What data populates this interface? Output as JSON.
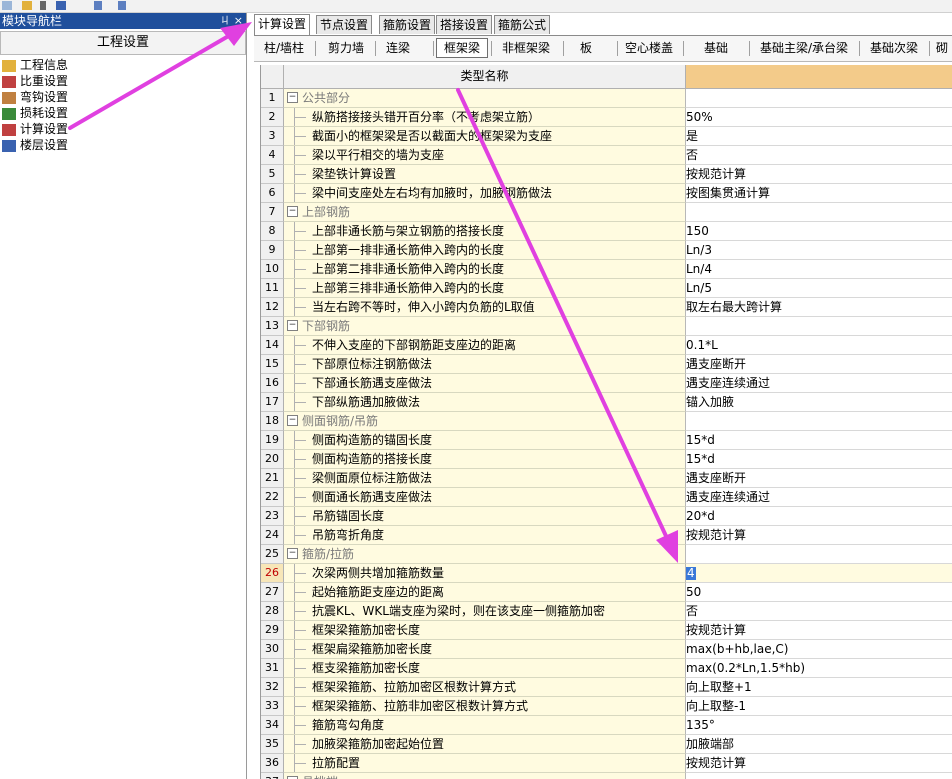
{
  "nav": {
    "title": "模块导航栏",
    "pin": "ㄐ",
    "close": "×",
    "header": "工程设置",
    "items": [
      {
        "label": "工程信息",
        "icon": "info-icon"
      },
      {
        "label": "比重设置",
        "icon": "scale-icon"
      },
      {
        "label": "弯钩设置",
        "icon": "hook-icon"
      },
      {
        "label": "损耗设置",
        "icon": "loss-icon"
      },
      {
        "label": "计算设置",
        "icon": "calc-icon"
      },
      {
        "label": "楼层设置",
        "icon": "floor-icon"
      }
    ]
  },
  "tabs": [
    "计算设置",
    "节点设置",
    "箍筋设置",
    "搭接设置",
    "箍筋公式"
  ],
  "categories": [
    "柱/墙柱",
    "剪力墙",
    "连梁",
    "框架梁",
    "非框架梁",
    "板",
    "空心楼盖",
    "基础",
    "基础主梁/承台梁",
    "基础次梁",
    "砌"
  ],
  "grid": {
    "header": "类型名称",
    "rows": [
      {
        "n": "1",
        "name": "公共部分",
        "value": "",
        "group": true
      },
      {
        "n": "2",
        "name": "纵筋搭接接头错开百分率（不考虑架立筋）",
        "value": "50%"
      },
      {
        "n": "3",
        "name": "截面小的框架梁是否以截面大的框架梁为支座",
        "value": "是"
      },
      {
        "n": "4",
        "name": "梁以平行相交的墙为支座",
        "value": "否"
      },
      {
        "n": "5",
        "name": "梁垫铁计算设置",
        "value": "按规范计算"
      },
      {
        "n": "6",
        "name": "梁中间支座处左右均有加腋时，加腋钢筋做法",
        "value": "按图集贯通计算"
      },
      {
        "n": "7",
        "name": "上部钢筋",
        "value": "",
        "group": true
      },
      {
        "n": "8",
        "name": "上部非通长筋与架立钢筋的搭接长度",
        "value": "150"
      },
      {
        "n": "9",
        "name": "上部第一排非通长筋伸入跨内的长度",
        "value": "Ln/3"
      },
      {
        "n": "10",
        "name": "上部第二排非通长筋伸入跨内的长度",
        "value": "Ln/4"
      },
      {
        "n": "11",
        "name": "上部第三排非通长筋伸入跨内的长度",
        "value": "Ln/5"
      },
      {
        "n": "12",
        "name": "当左右跨不等时，伸入小跨内负筋的L取值",
        "value": "取左右最大跨计算"
      },
      {
        "n": "13",
        "name": "下部钢筋",
        "value": "",
        "group": true
      },
      {
        "n": "14",
        "name": "不伸入支座的下部钢筋距支座边的距离",
        "value": "0.1*L"
      },
      {
        "n": "15",
        "name": "下部原位标注钢筋做法",
        "value": "遇支座断开"
      },
      {
        "n": "16",
        "name": "下部通长筋遇支座做法",
        "value": "遇支座连续通过"
      },
      {
        "n": "17",
        "name": "下部纵筋遇加腋做法",
        "value": "锚入加腋"
      },
      {
        "n": "18",
        "name": "侧面钢筋/吊筋",
        "value": "",
        "group": true
      },
      {
        "n": "19",
        "name": "侧面构造筋的锚固长度",
        "value": "15*d"
      },
      {
        "n": "20",
        "name": "侧面构造筋的搭接长度",
        "value": "15*d"
      },
      {
        "n": "21",
        "name": "梁侧面原位标注筋做法",
        "value": "遇支座断开"
      },
      {
        "n": "22",
        "name": "侧面通长筋遇支座做法",
        "value": "遇支座连续通过"
      },
      {
        "n": "23",
        "name": "吊筋锚固长度",
        "value": "20*d"
      },
      {
        "n": "24",
        "name": "吊筋弯折角度",
        "value": "按规范计算"
      },
      {
        "n": "25",
        "name": "箍筋/拉筋",
        "value": "",
        "group": true
      },
      {
        "n": "26",
        "name": "次梁两侧共增加箍筋数量",
        "value": "4",
        "selected": true
      },
      {
        "n": "27",
        "name": "起始箍筋距支座边的距离",
        "value": "50"
      },
      {
        "n": "28",
        "name": "抗震KL、WKL端支座为梁时，则在该支座一侧箍筋加密",
        "value": "否"
      },
      {
        "n": "29",
        "name": "框架梁箍筋加密长度",
        "value": "按规范计算"
      },
      {
        "n": "30",
        "name": "框架扁梁箍筋加密长度",
        "value": "max(b+hb,lae,C)"
      },
      {
        "n": "31",
        "name": "框支梁箍筋加密长度",
        "value": "max(0.2*Ln,1.5*hb)"
      },
      {
        "n": "32",
        "name": "框架梁箍筋、拉筋加密区根数计算方式",
        "value": "向上取整+1"
      },
      {
        "n": "33",
        "name": "框架梁箍筋、拉筋非加密区根数计算方式",
        "value": "向上取整-1"
      },
      {
        "n": "34",
        "name": "箍筋弯勾角度",
        "value": "135°"
      },
      {
        "n": "35",
        "name": "加腋梁箍筋加密起始位置",
        "value": "加腋端部"
      },
      {
        "n": "36",
        "name": "拉筋配置",
        "value": "按规范计算"
      },
      {
        "n": "37",
        "name": "悬挑端",
        "value": "",
        "group": true
      }
    ]
  },
  "colors": {
    "nav_title_bg": "#1f4f9c",
    "value_header_bg": "#f3cb8a",
    "name_cell_bg": "#fffbe0",
    "annotation_arrow": "#e040e0",
    "edit_highlight": "#3a78d8"
  }
}
